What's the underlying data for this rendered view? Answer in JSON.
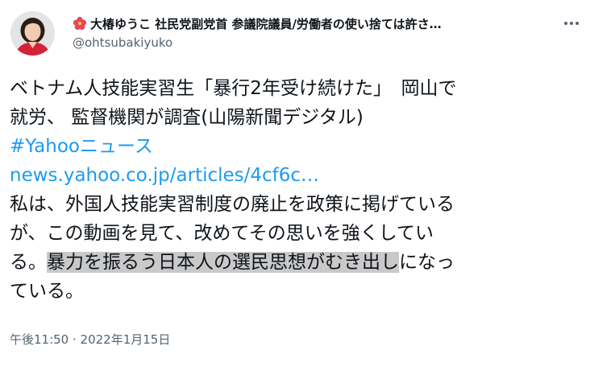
{
  "author": {
    "display_name": "大椿ゆうこ 社民党副党首 参議院議員/労働者の使い捨ては許さ…",
    "handle": "@ohtsubakiyuko",
    "name_icon": "hibiscus-flower-icon"
  },
  "tweet": {
    "line1": "ベトナム人技能実習生「暴行2年受け続けた」　岡山で",
    "line2": "就労、 監督機関が調査(山陽新聞デジタル)",
    "hashtag": "#Yahooニュース",
    "url": "news.yahoo.co.jp/articles/4cf6c…",
    "line5": "私は、外国人技能実習制度の廃止を政策に掲げている",
    "line6": "が、この動画を見て、改めてその思いを強くしてい",
    "line7_pre": "る。",
    "line7_highlight": "暴力を振るう日本人の選民思想がむき出し",
    "line7_post": "になっ",
    "line8": "ている。",
    "timestamp": "午後11:50 · 2022年1月15日"
  },
  "colors": {
    "link": "#1d9bf0",
    "secondary_text": "#536471",
    "highlight": "#c9c9c9",
    "flower": "#e8455a"
  },
  "icons": {
    "more": "more-options-icon",
    "avatar": "avatar"
  }
}
